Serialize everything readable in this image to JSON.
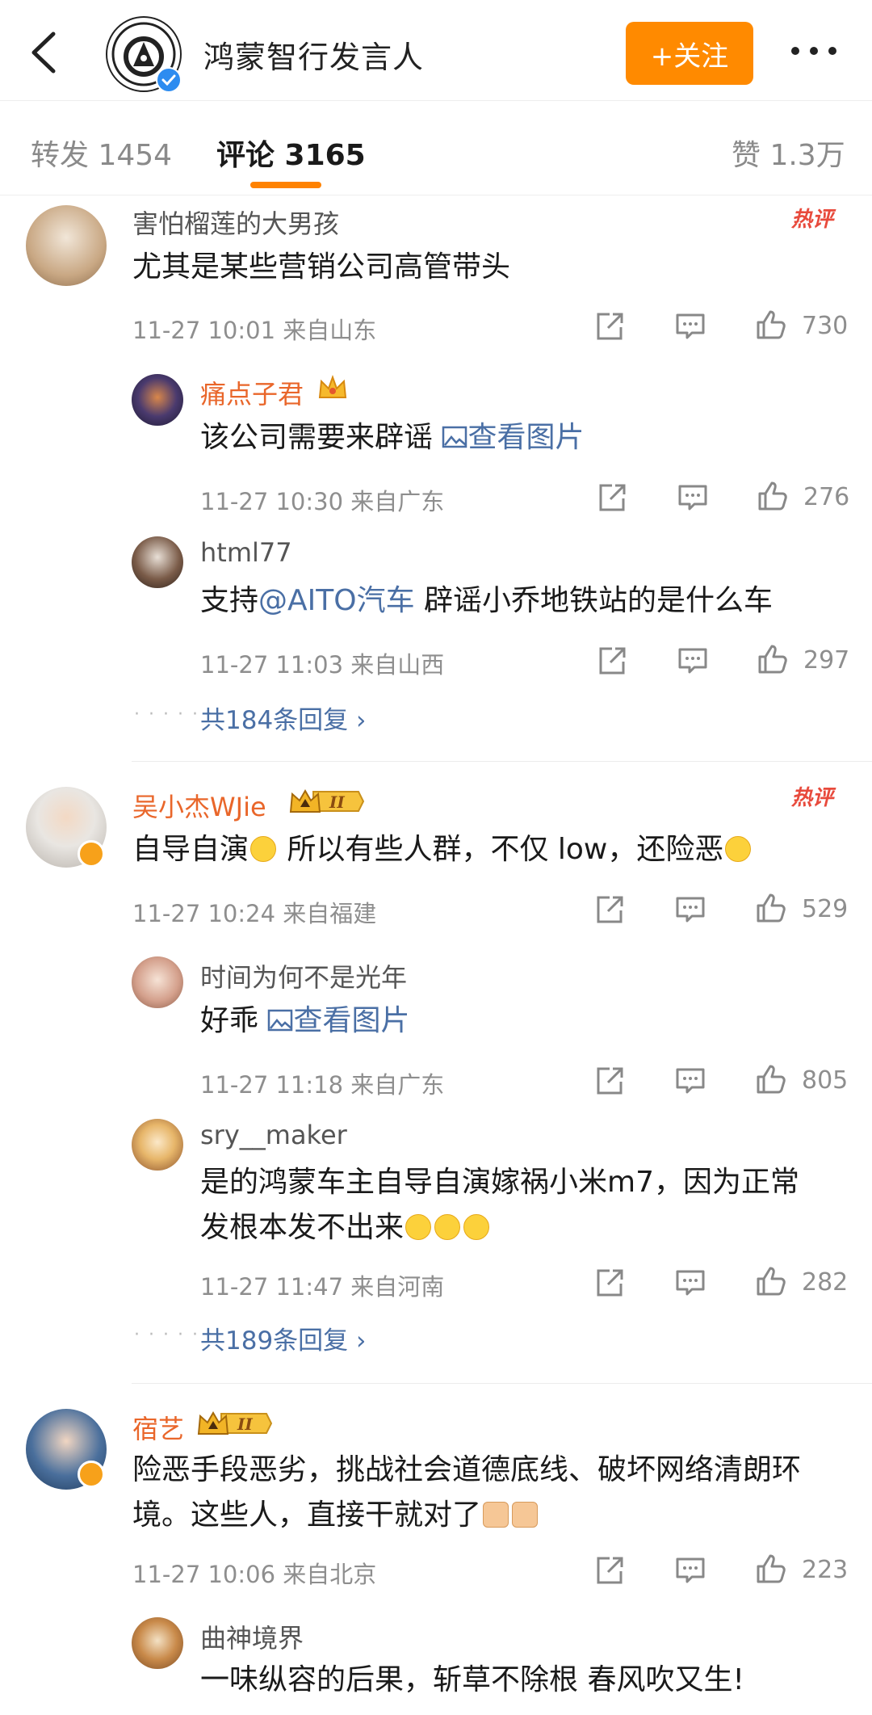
{
  "header": {
    "title": "鸿蒙智行发言人",
    "follow_label": "+关注"
  },
  "tabs": {
    "repost": "转发 1454",
    "comments": "评论 3165",
    "likes": "赞 1.3万"
  },
  "hot_label": "热评",
  "comments": [
    {
      "user": "害怕榴莲的大男孩",
      "text": "尤其是某些营销公司高管带头",
      "meta": "11-27 10:01 来自山东",
      "likes": "730",
      "replies": [
        {
          "user": "痛点子君",
          "text": "该公司需要来辟谣 ",
          "link": "查看图片",
          "meta": "11-27 10:30 来自广东",
          "likes": "276"
        },
        {
          "user": "html77",
          "text_prefix": "支持",
          "mention": "@AITO汽车",
          "text": " 辟谣小乔地铁站的是什么车",
          "meta": "11-27 11:03 来自山西",
          "likes": "297"
        }
      ],
      "more_replies": "共184条回复"
    },
    {
      "user": "吴小杰WJie",
      "text_a": "自导自演",
      "text_b": " 所以有些人群，不仅 low，还险恶",
      "meta": "11-27 10:24 来自福建",
      "likes": "529",
      "replies": [
        {
          "user": "时间为何不是光年",
          "text": "好乖 ",
          "link": "查看图片",
          "meta": "11-27 11:18 来自广东",
          "likes": "805"
        },
        {
          "user": "sry__maker",
          "text_line1": "是的鸿蒙车主自导自演嫁祸小米m7，因为正常",
          "text_line2": "发根本发不出来",
          "meta": "11-27 11:47 来自河南",
          "likes": "282"
        }
      ],
      "more_replies": "共189条回复"
    },
    {
      "user": "宿艺",
      "text_line1": "险恶手段恶劣，挑战社会道德底线、破坏网络清朗环",
      "text_line2": "境。这些人，直接干就对了",
      "meta": "11-27 10:06 来自北京",
      "likes": "223",
      "replies": [
        {
          "user": "曲神境界",
          "text": "一味纵容的后果，斩草不除根 春风吹又生!"
        }
      ]
    }
  ],
  "colors": {
    "accent": "#ff8200",
    "follow_bg": "#ff8a00",
    "link": "#4a6fa5",
    "vip_name": "#e9662a"
  }
}
